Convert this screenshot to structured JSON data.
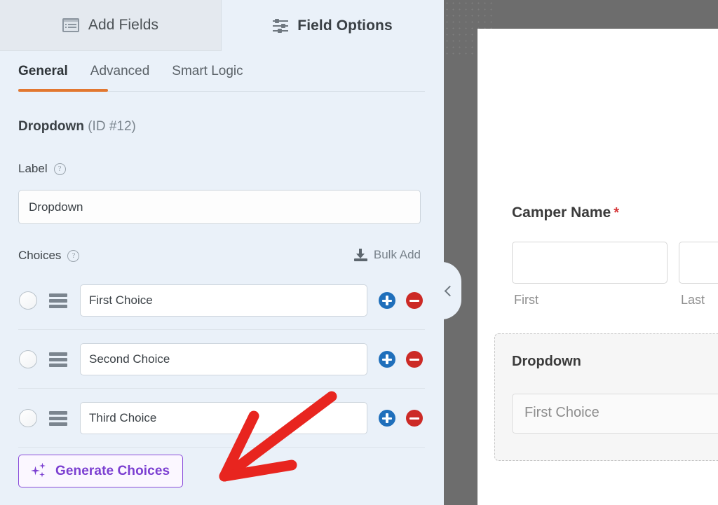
{
  "tabs": {
    "add_fields": {
      "label": "Add Fields",
      "icon": "form-list-icon"
    },
    "field_options": {
      "label": "Field Options",
      "icon": "sliders-icon"
    }
  },
  "subtabs": [
    {
      "label": "General",
      "active": true
    },
    {
      "label": "Advanced",
      "active": false
    },
    {
      "label": "Smart Logic",
      "active": false
    }
  ],
  "field": {
    "type_title": "Dropdown",
    "id_text": "(ID #12)",
    "label_section": {
      "title": "Label",
      "help_icon": "question-mark-icon",
      "value": "Dropdown"
    },
    "choices_section": {
      "title": "Choices",
      "help_icon": "question-mark-icon",
      "bulk_add_label": "Bulk Add",
      "bulk_add_icon": "download-icon",
      "rows": [
        {
          "value": "First Choice",
          "add_icon": "plus-circle-icon",
          "remove_icon": "minus-circle-icon"
        },
        {
          "value": "Second Choice",
          "add_icon": "plus-circle-icon",
          "remove_icon": "minus-circle-icon"
        },
        {
          "value": "Third Choice",
          "add_icon": "plus-circle-icon",
          "remove_icon": "minus-circle-icon"
        }
      ]
    },
    "generate_choices": {
      "label": "Generate Choices",
      "icon": "sparkle-icon"
    }
  },
  "preview": {
    "camper_name": {
      "label": "Camper Name",
      "required_marker": "*"
    },
    "name_sublabels": {
      "first": "First",
      "last": "Last"
    },
    "dropdown_field": {
      "label": "Dropdown",
      "selected": "First Choice"
    }
  },
  "collapse_panel": {
    "icon": "chevron-left-icon"
  },
  "annotation": {
    "type": "arrow",
    "color": "#e8251f"
  },
  "colors": {
    "panel_bg": "#eaf1f9",
    "tab_inactive_bg": "#e4e9ef",
    "active_underline": "#e27730",
    "add_button": "#1f6fbb",
    "remove_button": "#cc2a26",
    "generate_accent": "#7b3fd1",
    "stage_bg": "#6d6d6d",
    "required_star": "#d63638",
    "annotation_red": "#e8251f"
  }
}
